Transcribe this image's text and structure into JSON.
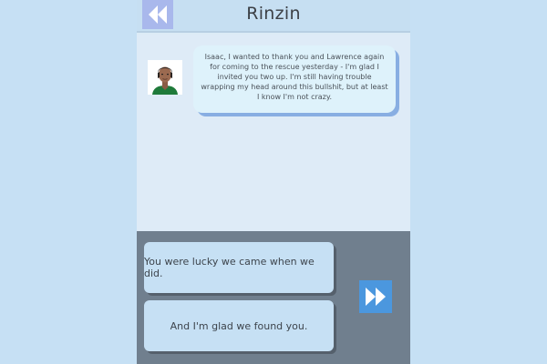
{
  "header": {
    "contact_name": "Rinzin",
    "back_icon": "back-arrow-icon"
  },
  "message": {
    "sender_avatar": "avatar-icon",
    "text": "Isaac, I wanted to thank you and Lawrence again for coming to the rescue yesterday - I'm glad I invited you two up. I'm still having trouble wrapping my head around this bullshit, but at least I know I'm not crazy."
  },
  "choices": [
    {
      "label": "You were lucky we came when we did."
    },
    {
      "label": "And I'm glad we found you."
    }
  ],
  "controls": {
    "fast_forward_icon": "fast-forward-icon"
  },
  "colors": {
    "background": "#c6e0f4",
    "header": "#c6dff2",
    "back_button": "#a9b8ec",
    "bubble": "#def2fb",
    "bubble_shadow": "#88aee2",
    "reply_panel": "#707f8e",
    "choice": "#c6e0f4",
    "fast_forward": "#4b97de"
  }
}
